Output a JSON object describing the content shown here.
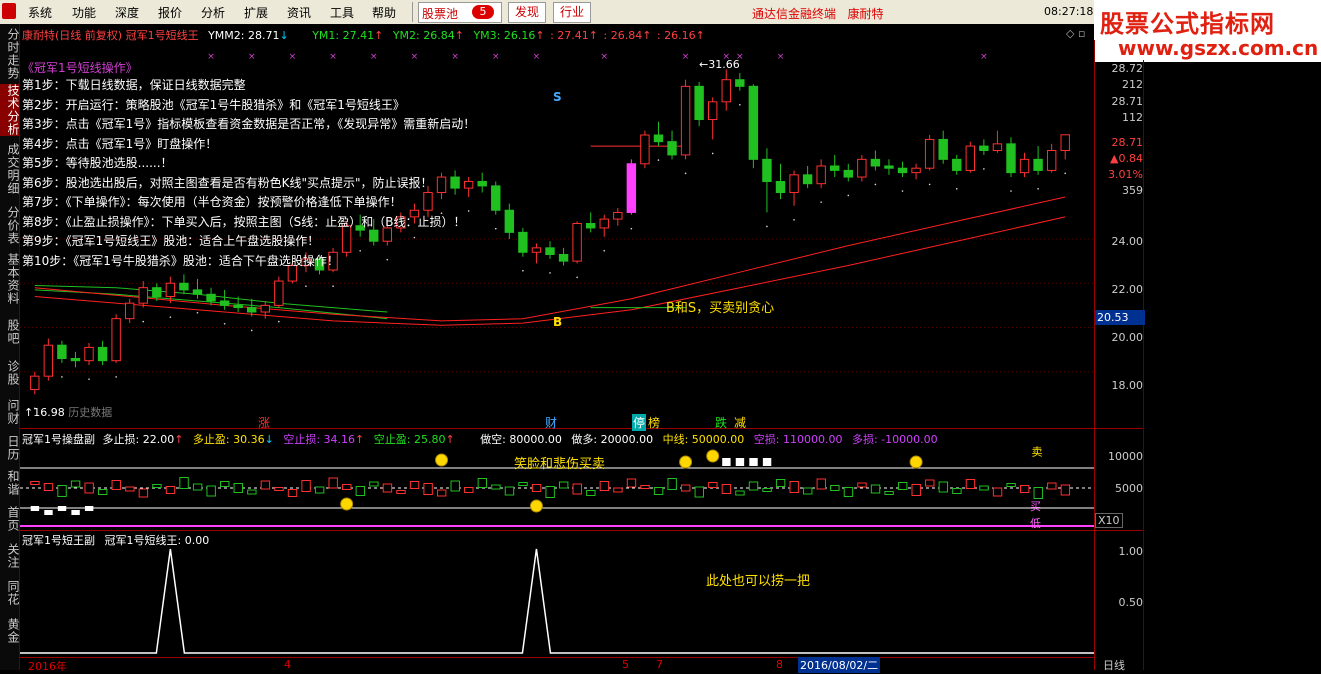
{
  "menu": {
    "items": [
      "系统",
      "功能",
      "深度",
      "报价",
      "分析",
      "扩展",
      "资讯",
      "工具",
      "帮助"
    ],
    "stock_pool": "股票池",
    "stock_pool_count": "5",
    "discover": "发现",
    "industry": "行业",
    "app_title": "通达信金融终端",
    "stock_name_title": "康耐特",
    "clock": "08:27:18"
  },
  "watermark": {
    "line1": "股票公式指标网",
    "line2": "www.gszx.com.cn"
  },
  "sidebar": {
    "tabs": [
      "分时走势",
      "技术分析",
      "成交明细",
      "分价表",
      "基本资料",
      "股吧",
      "诊股",
      "问财",
      "日历",
      "和谐",
      "首页",
      "关注",
      "同花",
      "黄金"
    ],
    "active_index": 1
  },
  "main_header": {
    "stock": "康耐特(日线 前复权) 冠军1号短线王",
    "ymm2": "YMM2: 28.71",
    "ym1": "YM1: 27.41",
    "ym2": "YM2: 26.84",
    "ym3": "YM3: 26.16",
    "extra1": ": 27.41",
    "extra2": ": 26.84",
    "extra3": ": 26.16"
  },
  "guide": {
    "title": "《冠军1号短线操作》",
    "steps": [
      "第1步：下载日线数据，保证日线数据完整",
      "第2步：开启运行：策略股池《冠军1号牛股猎杀》和《冠军1号短线王》",
      "第3步：点击《冠军1号》指标模板查看资金数据是否正常，《发现异常》需重新启动！",
      "第4步：点击《冠军1号》盯盘操作！",
      "第5步：等待股池选股......！",
      "第6步：股池选出股后，对照主图查看是否有粉色K线\"买点提示\"，防止误报！",
      "第7步：《下单操作》：每次使用（半仓资金）按预警价格逢低下单操作！",
      "第8步：《止盈止损操作》：下单买入后，按照主图（S线：止盈）和（B线：止损）！",
      "第9步：《冠军1号短线王》股池：适合上午盘选股操作！",
      "第10步：《冠军1号牛股猎杀》股池：适合下午盘选股操作！"
    ]
  },
  "main_annotations": {
    "s_label": "S",
    "b_label": "B",
    "note": "B和S，买卖别贪心",
    "high_label": "31.66",
    "low_label": "16.98",
    "lowdata": "历史数据",
    "events": [
      "涨",
      "财",
      "停",
      "榜",
      "跌",
      "减"
    ]
  },
  "right_panel": {
    "values": [
      "28.72",
      "212",
      "28.71",
      "112",
      "28.71",
      "▲0.84",
      "3.01%",
      "359"
    ],
    "current_price": "20.53"
  },
  "y_axis_main": [
    "24.00",
    "22.00",
    "20.00",
    "18.00"
  ],
  "sub1_header": {
    "title": "冠军1号操盘副",
    "stop_loss_long": "多止损: 22.00",
    "take_profit_long": "多止盈: 30.36",
    "stop_loss_short": "空止损: 34.16",
    "take_profit_short": "空止盈: 25.80",
    "short": "做空: 80000.00",
    "long": "做多: 20000.00",
    "midline": "中线: 50000.00",
    "short_loss": "空损: 110000.00",
    "long_loss": "多损: -10000.00"
  },
  "sub1_annotation": "笑脸和悲伤买卖",
  "sub1_right": [
    "卖",
    "买",
    "低"
  ],
  "sub1_y_axis": [
    "10000",
    "5000"
  ],
  "sub1_scale": "X10",
  "sub2_header": {
    "title": "冠军1号短王副",
    "value": "冠军1号短线王: 0.00"
  },
  "sub2_annotation": "此处也可以捞一把",
  "sub2_y_axis": [
    "1.00",
    "0.50"
  ],
  "bottom_axis": {
    "labels": [
      "2016年",
      "4",
      "5",
      "7",
      "8"
    ],
    "selected_date": "2016/08/02/二",
    "period": "日线"
  },
  "colors": {
    "up": "#ff3030",
    "down": "#20c020",
    "buy_candle": "#ff40ff",
    "ma1": "#ff2020",
    "ma2": "#20c020",
    "accent": "#d00000"
  },
  "chart_data": {
    "type": "candlestick",
    "ylim": [
      16.0,
      32.0
    ],
    "candles": [
      [
        17.2,
        18.0,
        16.98,
        17.8
      ],
      [
        17.8,
        19.5,
        17.6,
        19.2
      ],
      [
        19.2,
        19.4,
        18.4,
        18.6
      ],
      [
        18.6,
        18.9,
        18.2,
        18.5
      ],
      [
        18.5,
        19.3,
        18.3,
        19.1
      ],
      [
        19.1,
        19.4,
        18.3,
        18.5
      ],
      [
        18.5,
        20.6,
        18.4,
        20.4
      ],
      [
        20.4,
        21.3,
        20.2,
        21.1
      ],
      [
        21.1,
        22.1,
        20.9,
        21.8
      ],
      [
        21.8,
        22.0,
        21.2,
        21.4
      ],
      [
        21.4,
        22.3,
        21.1,
        22.0
      ],
      [
        22.0,
        22.4,
        21.5,
        21.7
      ],
      [
        21.7,
        22.2,
        21.3,
        21.5
      ],
      [
        21.5,
        21.8,
        21.0,
        21.2
      ],
      [
        21.2,
        21.7,
        20.8,
        21.0
      ],
      [
        21.0,
        21.4,
        20.7,
        20.9
      ],
      [
        20.9,
        21.3,
        20.5,
        20.7
      ],
      [
        20.7,
        21.2,
        20.4,
        21.0
      ],
      [
        21.0,
        22.3,
        20.9,
        22.1
      ],
      [
        22.1,
        23.0,
        22.0,
        22.8
      ],
      [
        22.8,
        23.4,
        22.5,
        23.1
      ],
      [
        23.1,
        23.3,
        22.4,
        22.6
      ],
      [
        22.6,
        23.6,
        22.5,
        23.4
      ],
      [
        23.4,
        24.8,
        23.2,
        24.6
      ],
      [
        24.6,
        25.1,
        24.1,
        24.4
      ],
      [
        24.4,
        24.9,
        23.7,
        23.9
      ],
      [
        23.9,
        24.7,
        23.7,
        24.5
      ],
      [
        24.5,
        25.2,
        24.3,
        25.0
      ],
      [
        25.0,
        25.6,
        24.7,
        25.3
      ],
      [
        25.3,
        26.4,
        25.0,
        26.1
      ],
      [
        26.1,
        27.0,
        25.8,
        26.8
      ],
      [
        26.8,
        27.1,
        26.0,
        26.3
      ],
      [
        26.3,
        26.8,
        25.9,
        26.6
      ],
      [
        26.6,
        27.0,
        26.1,
        26.4
      ],
      [
        26.4,
        26.6,
        25.1,
        25.3
      ],
      [
        25.3,
        25.6,
        24.0,
        24.3
      ],
      [
        24.3,
        24.5,
        23.2,
        23.4
      ],
      [
        23.4,
        23.8,
        22.9,
        23.6
      ],
      [
        23.6,
        23.9,
        23.1,
        23.3
      ],
      [
        23.3,
        23.6,
        22.8,
        23.0
      ],
      [
        23.0,
        24.8,
        22.9,
        24.7
      ],
      [
        24.7,
        25.2,
        24.3,
        24.5
      ],
      [
        24.5,
        25.1,
        24.1,
        24.9
      ],
      [
        24.9,
        25.4,
        24.6,
        25.2
      ],
      [
        25.2,
        27.6,
        25.1,
        27.4
      ],
      [
        27.4,
        28.9,
        27.2,
        28.7
      ],
      [
        28.7,
        29.3,
        28.2,
        28.4
      ],
      [
        28.4,
        28.9,
        27.6,
        27.8
      ],
      [
        27.8,
        31.2,
        27.6,
        30.9
      ],
      [
        30.9,
        31.1,
        29.1,
        29.4
      ],
      [
        29.4,
        30.4,
        28.5,
        30.2
      ],
      [
        30.2,
        31.66,
        29.8,
        31.2
      ],
      [
        31.2,
        31.5,
        30.7,
        30.9
      ],
      [
        30.9,
        31.0,
        27.2,
        27.6
      ],
      [
        27.6,
        28.1,
        25.2,
        26.6
      ],
      [
        26.6,
        27.4,
        25.8,
        26.1
      ],
      [
        26.1,
        27.1,
        25.5,
        26.9
      ],
      [
        26.9,
        27.3,
        26.3,
        26.5
      ],
      [
        26.5,
        27.6,
        26.3,
        27.3
      ],
      [
        27.3,
        27.8,
        26.8,
        27.1
      ],
      [
        27.1,
        27.4,
        26.6,
        26.8
      ],
      [
        26.8,
        27.8,
        26.6,
        27.6
      ],
      [
        27.6,
        28.0,
        27.1,
        27.3
      ],
      [
        27.3,
        27.6,
        26.9,
        27.2
      ],
      [
        27.2,
        27.5,
        26.8,
        27.0
      ],
      [
        27.0,
        27.4,
        26.7,
        27.2
      ],
      [
        27.2,
        28.7,
        27.1,
        28.5
      ],
      [
        28.5,
        28.9,
        27.4,
        27.6
      ],
      [
        27.6,
        27.8,
        26.9,
        27.1
      ],
      [
        27.1,
        28.4,
        27.0,
        28.2
      ],
      [
        28.2,
        28.5,
        27.8,
        28.0
      ],
      [
        28.0,
        28.9,
        27.9,
        28.3
      ],
      [
        28.3,
        28.6,
        26.8,
        27.0
      ],
      [
        27.0,
        27.9,
        26.8,
        27.6
      ],
      [
        27.6,
        28.2,
        26.9,
        27.1
      ],
      [
        27.1,
        28.3,
        27.0,
        28.0
      ],
      [
        28.0,
        28.6,
        27.6,
        28.71
      ]
    ],
    "buy_candle_index": 44,
    "ma_red": [
      {
        "x": 0,
        "y": 21.8
      },
      {
        "x": 14,
        "y": 21.0
      },
      {
        "x": 22,
        "y": 20.6
      },
      {
        "x": 30,
        "y": 20.3
      },
      {
        "x": 36,
        "y": 20.4
      },
      {
        "x": 44,
        "y": 21.3
      },
      {
        "x": 52,
        "y": 22.5
      },
      {
        "x": 60,
        "y": 23.7
      },
      {
        "x": 68,
        "y": 24.8
      },
      {
        "x": 76,
        "y": 25.9
      }
    ],
    "ma_red2": [
      {
        "x": 0,
        "y": 21.4
      },
      {
        "x": 14,
        "y": 20.7
      },
      {
        "x": 22,
        "y": 20.3
      },
      {
        "x": 30,
        "y": 20.1
      },
      {
        "x": 36,
        "y": 20.2
      },
      {
        "x": 44,
        "y": 20.8
      },
      {
        "x": 52,
        "y": 21.8
      },
      {
        "x": 60,
        "y": 22.8
      },
      {
        "x": 68,
        "y": 23.9
      },
      {
        "x": 76,
        "y": 25.0
      }
    ],
    "ma_green": [
      {
        "x": 0,
        "y": 21.9
      },
      {
        "x": 6,
        "y": 21.8
      },
      {
        "x": 12,
        "y": 21.5
      },
      {
        "x": 18,
        "y": 21.1
      },
      {
        "x": 26,
        "y": 20.7
      }
    ],
    "ma_green2": [
      {
        "x": 0,
        "y": 21.7
      },
      {
        "x": 6,
        "y": 21.5
      },
      {
        "x": 12,
        "y": 21.2
      },
      {
        "x": 18,
        "y": 20.9
      },
      {
        "x": 26,
        "y": 20.4
      }
    ],
    "sub2_spikes": [
      10,
      37
    ]
  }
}
